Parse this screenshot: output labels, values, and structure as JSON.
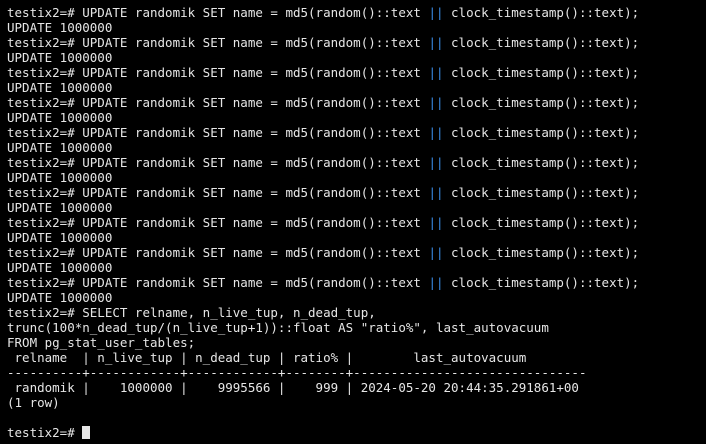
{
  "terminal": {
    "background": "#000000",
    "foreground": "#e6e6e6",
    "operator_color": "#3b8eea",
    "update_cmd_prefix": "testix2=# UPDATE randomik SET name = md5(random()::text ",
    "update_operator": "||",
    "update_cmd_suffix": " clock_timestamp()::text);",
    "update_result": "UPDATE 1000000",
    "select_lines": [
      "testix2=# SELECT relname, n_live_tup, n_dead_tup,",
      "trunc(100*n_dead_tup/(n_live_tup+1))::float AS \"ratio%\", last_autovacuum",
      "FROM pg_stat_user_tables;"
    ],
    "table_header": " relname  | n_live_tup | n_dead_tup | ratio% |        last_autovacuum",
    "table_separator": "----------+------------+------------+--------+-------------------------------",
    "table_row": " randomik |    1000000 |    9995566 |    999 | 2024-05-20 20:44:35.291861+00",
    "row_count": "(1 row)",
    "final_prompt": "testix2=# "
  }
}
